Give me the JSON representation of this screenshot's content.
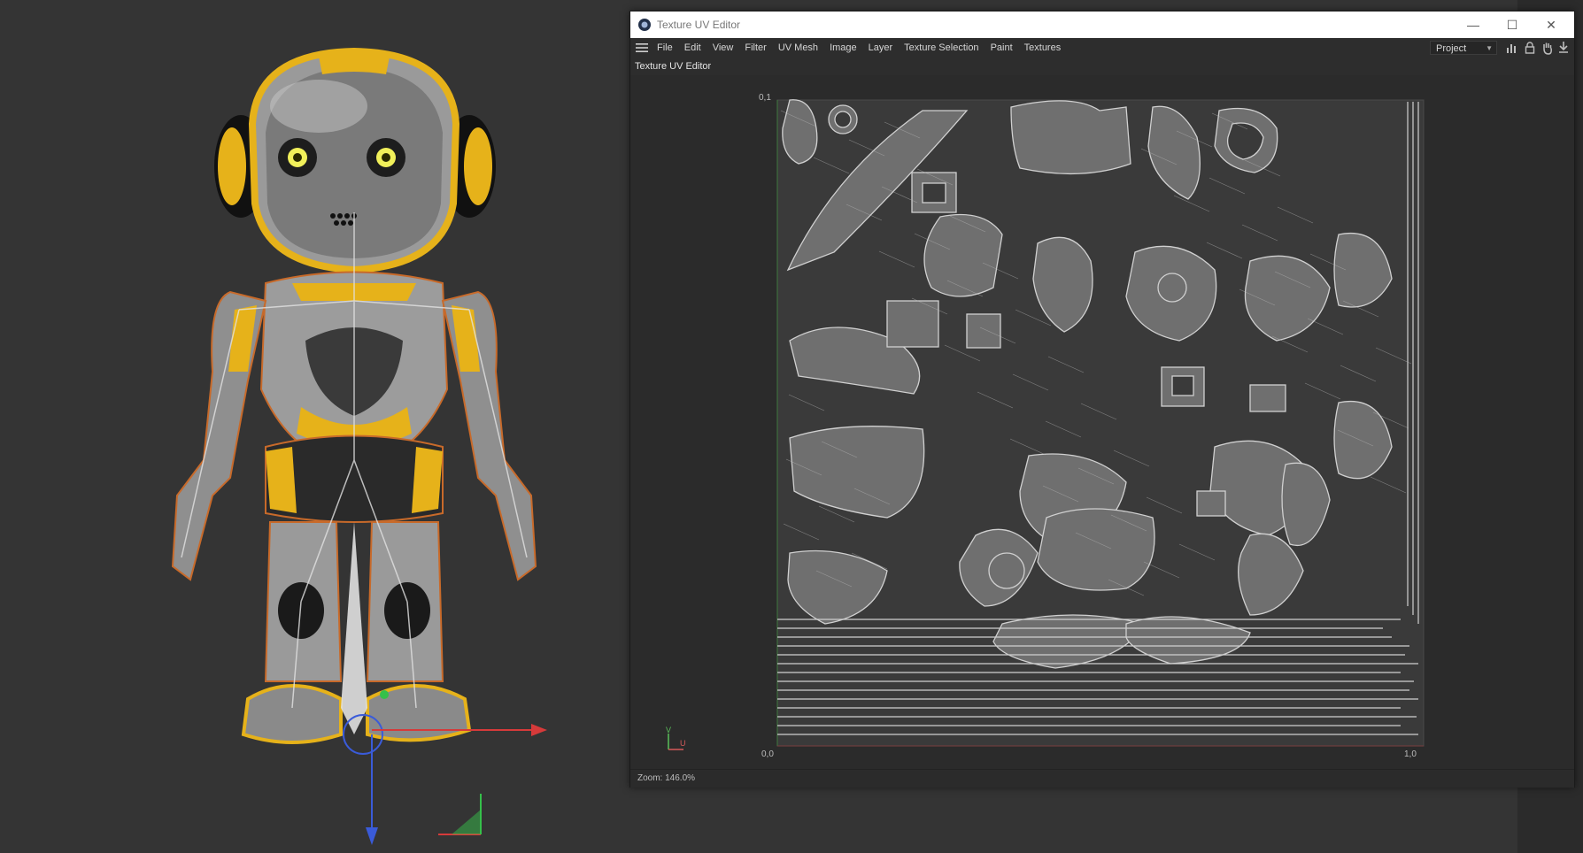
{
  "window": {
    "title": "Texture UV Editor",
    "minimize_glyph": "—",
    "maximize_glyph": "☐",
    "close_glyph": "✕"
  },
  "menu": {
    "items": [
      "File",
      "Edit",
      "View",
      "Filter",
      "UV Mesh",
      "Image",
      "Layer",
      "Texture Selection",
      "Paint",
      "Textures"
    ],
    "project_select": "Project"
  },
  "panel": {
    "label": "Texture UV Editor"
  },
  "uv_axes": {
    "top_left": "0,1",
    "origin": "0,0",
    "bottom_right": "1,0",
    "v_axis": "V",
    "u_axis": "U"
  },
  "status": {
    "zoom": "Zoom: 146.0%"
  },
  "icons": {
    "app": "cinema4d-logo-icon",
    "menu": "hamburger-menu-icon",
    "toolbar": [
      "statistics-icon",
      "lock-icon",
      "hand-pan-icon",
      "pin-icon"
    ]
  },
  "colors": {
    "accent_yellow": "#e6b21a",
    "selection_orange": "#c86a2a",
    "uv_lines": "#c9c9c9",
    "background": "#343434"
  }
}
